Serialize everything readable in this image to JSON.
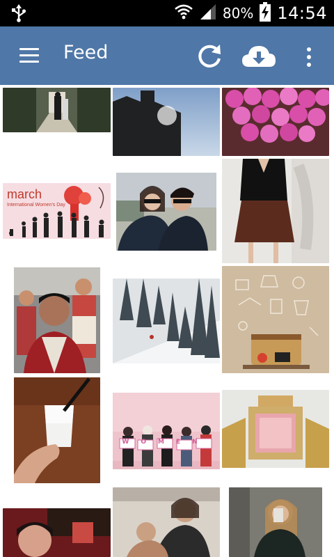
{
  "status_bar": {
    "battery": "80%",
    "time": "14:54",
    "icons": [
      "usb-icon",
      "wifi-icon",
      "signal-icon",
      "battery-charging-icon"
    ]
  },
  "app_bar": {
    "title": "Feed",
    "icons": [
      "menu-icon",
      "refresh-icon",
      "cloud-download-icon",
      "more-vert-icon"
    ]
  },
  "feed": {
    "tiles": [
      {
        "caption": "",
        "overlay_text": ""
      },
      {
        "caption": "",
        "overlay_text": ""
      },
      {
        "caption": "",
        "overlay_text": ""
      },
      {
        "caption": "march",
        "overlay_text": "International Women's Day"
      },
      {
        "caption": "",
        "overlay_text": ""
      },
      {
        "caption": "",
        "overlay_text": ""
      },
      {
        "caption": "",
        "overlay_text": ""
      },
      {
        "caption": "",
        "overlay_text": ""
      },
      {
        "caption": "",
        "overlay_text": ""
      },
      {
        "caption": "",
        "overlay_text": ""
      },
      {
        "caption": "WOMEN",
        "overlay_text": ""
      },
      {
        "caption": "",
        "overlay_text": ""
      },
      {
        "caption": "",
        "overlay_text": ""
      },
      {
        "caption": "",
        "overlay_text": ""
      },
      {
        "caption": "",
        "overlay_text": ""
      }
    ]
  },
  "colors": {
    "status_bar_bg": "#000000",
    "app_bar_bg": "#4f77a7",
    "feed_bg": "#ffffff"
  }
}
